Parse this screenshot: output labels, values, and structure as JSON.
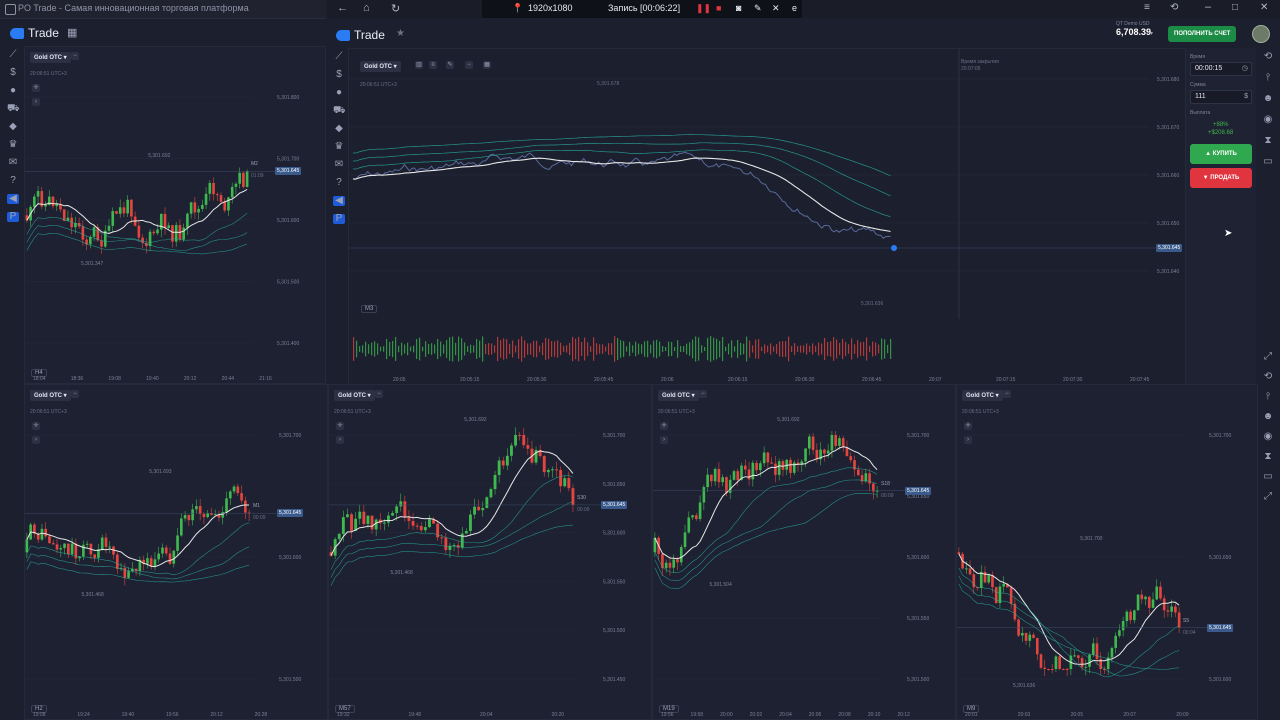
{
  "left_window": {
    "title": "PO Trade - Самая инновационная торговая платформа"
  },
  "recorder": {
    "resolution": "1920x1080",
    "status": "Запись [00:06:22]",
    "suffix": "e"
  },
  "app": {
    "logo": "Trade",
    "account_type": "QT Demo",
    "currency": "USD",
    "balance": "6,708.39",
    "deposit_button": "ПОПОЛНИТЬ СЧЕТ"
  },
  "trade_panel": {
    "time_label": "Время",
    "time_value": "00:00:15",
    "amount_label": "Сумма",
    "amount_value": "111",
    "payout_label": "Выплата",
    "payout_percent": "+88%",
    "payout_amount": "+$208.68",
    "buy_label": "КУПИТЬ",
    "sell_label": "ПРОДАТЬ"
  },
  "main_chart": {
    "asset": "Gold OTC",
    "datetime": "20:06:51 UTC+3",
    "timeframe": "M3",
    "close_label": "Время закрытия",
    "close_time": "20:07:05",
    "high_label": "5,301.678",
    "low_label": "5,301.636",
    "current_price": "5,301.645",
    "price_ticks": [
      "5,301.680",
      "5,301.670",
      "5,301.660",
      "5,301.650",
      "5,301.640"
    ],
    "time_ticks": [
      "20:05",
      "20:05:15",
      "20:05:30",
      "20:05:45",
      "20:06",
      "20:06:15",
      "20:06:30",
      "20:06:45",
      "20:07",
      "20:07:15",
      "20:07:30",
      "20:07:45"
    ]
  },
  "panels": [
    {
      "asset": "Gold OTC",
      "datetime": "20:06:51 UTC+3",
      "timeframe": "H4",
      "high": "5,301.692",
      "low": "5,301.347",
      "current": "5,301.645",
      "countdown_tf": "M2",
      "countdown": "01:09",
      "price_ticks": [
        "5,301.800",
        "5,301.700",
        "5,301.600",
        "5,301.500",
        "5,301.400"
      ],
      "time_ticks": [
        "18:04",
        "18:36",
        "19:08",
        "19:40",
        "20:12",
        "20:44",
        "21:16"
      ]
    },
    {
      "asset": "Gold OTC",
      "datetime": "20:06:51 UTC+3",
      "timeframe": "H2",
      "high": "5,301.693",
      "low": "5,301.468",
      "current": "5,301.645",
      "countdown_tf": "M1",
      "countdown": "00:09",
      "price_ticks": [
        "5,301.700",
        "5,301.600",
        "5,301.500"
      ],
      "time_ticks": [
        "19:08",
        "19:24",
        "19:40",
        "19:56",
        "20:12",
        "20:28"
      ]
    },
    {
      "asset": "Gold OTC",
      "datetime": "20:06:51 UTC+3",
      "timeframe": "M57",
      "high": "5,301.692",
      "low": "5,301.468",
      "current": "5,301.645",
      "countdown_tf": "S30",
      "countdown": "00:09",
      "price_ticks": [
        "5,301.700",
        "5,301.650",
        "5,301.600",
        "5,301.550",
        "5,301.500",
        "5,301.450"
      ],
      "time_ticks": [
        "19:32",
        "19:48",
        "20:04",
        "20:20"
      ]
    },
    {
      "asset": "Gold OTC",
      "datetime": "20:06:51 UTC+3",
      "timeframe": "M19",
      "high": "5,301.692",
      "low": "5,301.504",
      "current": "5,301.645",
      "countdown_tf": "S18",
      "countdown": "00:09",
      "price_ticks": [
        "5,301.700",
        "5,301.650",
        "5,301.600",
        "5,301.550",
        "5,301.500"
      ],
      "time_ticks": [
        "19:56",
        "19:58",
        "20:00",
        "20:02",
        "20:04",
        "20:06",
        "20:08",
        "20:10",
        "20:12"
      ]
    },
    {
      "asset": "Gold OTC",
      "datetime": "20:06:51 UTC+3",
      "timeframe": "M9",
      "high": "5,301.700",
      "low": "5,301.636",
      "current": "5,301.645",
      "countdown_tf": "S5",
      "countdown": "00:04",
      "price_ticks": [
        "5,301.700",
        "5,301.650",
        "5,301.600"
      ],
      "time_ticks": [
        "20:01",
        "20:03",
        "20:05",
        "20:07",
        "20:09"
      ]
    }
  ],
  "colors": {
    "up": "#3fb84f",
    "down": "#e4463f",
    "accent": "#2b7bf5",
    "ma": "#e8e8e8",
    "ma2": "#2bb3a0"
  }
}
